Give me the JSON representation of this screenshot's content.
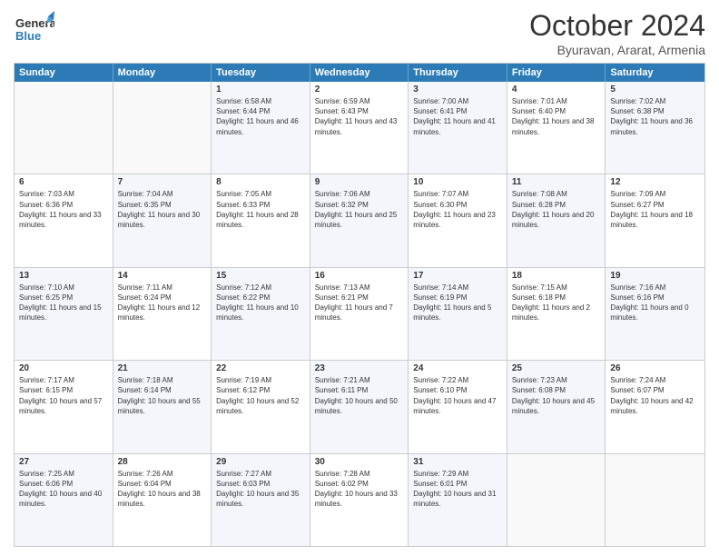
{
  "header": {
    "logo_general": "General",
    "logo_blue": "Blue",
    "month_title": "October 2024",
    "subtitle": "Byuravan, Ararat, Armenia"
  },
  "days_of_week": [
    "Sunday",
    "Monday",
    "Tuesday",
    "Wednesday",
    "Thursday",
    "Friday",
    "Saturday"
  ],
  "weeks": [
    [
      {
        "day": "",
        "sunrise": "",
        "sunset": "",
        "daylight": "",
        "empty": true
      },
      {
        "day": "",
        "sunrise": "",
        "sunset": "",
        "daylight": "",
        "empty": true
      },
      {
        "day": "1",
        "sunrise": "Sunrise: 6:58 AM",
        "sunset": "Sunset: 6:44 PM",
        "daylight": "Daylight: 11 hours and 46 minutes."
      },
      {
        "day": "2",
        "sunrise": "Sunrise: 6:59 AM",
        "sunset": "Sunset: 6:43 PM",
        "daylight": "Daylight: 11 hours and 43 minutes."
      },
      {
        "day": "3",
        "sunrise": "Sunrise: 7:00 AM",
        "sunset": "Sunset: 6:41 PM",
        "daylight": "Daylight: 11 hours and 41 minutes."
      },
      {
        "day": "4",
        "sunrise": "Sunrise: 7:01 AM",
        "sunset": "Sunset: 6:40 PM",
        "daylight": "Daylight: 11 hours and 38 minutes."
      },
      {
        "day": "5",
        "sunrise": "Sunrise: 7:02 AM",
        "sunset": "Sunset: 6:38 PM",
        "daylight": "Daylight: 11 hours and 36 minutes."
      }
    ],
    [
      {
        "day": "6",
        "sunrise": "Sunrise: 7:03 AM",
        "sunset": "Sunset: 6:36 PM",
        "daylight": "Daylight: 11 hours and 33 minutes."
      },
      {
        "day": "7",
        "sunrise": "Sunrise: 7:04 AM",
        "sunset": "Sunset: 6:35 PM",
        "daylight": "Daylight: 11 hours and 30 minutes."
      },
      {
        "day": "8",
        "sunrise": "Sunrise: 7:05 AM",
        "sunset": "Sunset: 6:33 PM",
        "daylight": "Daylight: 11 hours and 28 minutes."
      },
      {
        "day": "9",
        "sunrise": "Sunrise: 7:06 AM",
        "sunset": "Sunset: 6:32 PM",
        "daylight": "Daylight: 11 hours and 25 minutes."
      },
      {
        "day": "10",
        "sunrise": "Sunrise: 7:07 AM",
        "sunset": "Sunset: 6:30 PM",
        "daylight": "Daylight: 11 hours and 23 minutes."
      },
      {
        "day": "11",
        "sunrise": "Sunrise: 7:08 AM",
        "sunset": "Sunset: 6:28 PM",
        "daylight": "Daylight: 11 hours and 20 minutes."
      },
      {
        "day": "12",
        "sunrise": "Sunrise: 7:09 AM",
        "sunset": "Sunset: 6:27 PM",
        "daylight": "Daylight: 11 hours and 18 minutes."
      }
    ],
    [
      {
        "day": "13",
        "sunrise": "Sunrise: 7:10 AM",
        "sunset": "Sunset: 6:25 PM",
        "daylight": "Daylight: 11 hours and 15 minutes."
      },
      {
        "day": "14",
        "sunrise": "Sunrise: 7:11 AM",
        "sunset": "Sunset: 6:24 PM",
        "daylight": "Daylight: 11 hours and 12 minutes."
      },
      {
        "day": "15",
        "sunrise": "Sunrise: 7:12 AM",
        "sunset": "Sunset: 6:22 PM",
        "daylight": "Daylight: 11 hours and 10 minutes."
      },
      {
        "day": "16",
        "sunrise": "Sunrise: 7:13 AM",
        "sunset": "Sunset: 6:21 PM",
        "daylight": "Daylight: 11 hours and 7 minutes."
      },
      {
        "day": "17",
        "sunrise": "Sunrise: 7:14 AM",
        "sunset": "Sunset: 6:19 PM",
        "daylight": "Daylight: 11 hours and 5 minutes."
      },
      {
        "day": "18",
        "sunrise": "Sunrise: 7:15 AM",
        "sunset": "Sunset: 6:18 PM",
        "daylight": "Daylight: 11 hours and 2 minutes."
      },
      {
        "day": "19",
        "sunrise": "Sunrise: 7:16 AM",
        "sunset": "Sunset: 6:16 PM",
        "daylight": "Daylight: 11 hours and 0 minutes."
      }
    ],
    [
      {
        "day": "20",
        "sunrise": "Sunrise: 7:17 AM",
        "sunset": "Sunset: 6:15 PM",
        "daylight": "Daylight: 10 hours and 57 minutes."
      },
      {
        "day": "21",
        "sunrise": "Sunrise: 7:18 AM",
        "sunset": "Sunset: 6:14 PM",
        "daylight": "Daylight: 10 hours and 55 minutes."
      },
      {
        "day": "22",
        "sunrise": "Sunrise: 7:19 AM",
        "sunset": "Sunset: 6:12 PM",
        "daylight": "Daylight: 10 hours and 52 minutes."
      },
      {
        "day": "23",
        "sunrise": "Sunrise: 7:21 AM",
        "sunset": "Sunset: 6:11 PM",
        "daylight": "Daylight: 10 hours and 50 minutes."
      },
      {
        "day": "24",
        "sunrise": "Sunrise: 7:22 AM",
        "sunset": "Sunset: 6:10 PM",
        "daylight": "Daylight: 10 hours and 47 minutes."
      },
      {
        "day": "25",
        "sunrise": "Sunrise: 7:23 AM",
        "sunset": "Sunset: 6:08 PM",
        "daylight": "Daylight: 10 hours and 45 minutes."
      },
      {
        "day": "26",
        "sunrise": "Sunrise: 7:24 AM",
        "sunset": "Sunset: 6:07 PM",
        "daylight": "Daylight: 10 hours and 42 minutes."
      }
    ],
    [
      {
        "day": "27",
        "sunrise": "Sunrise: 7:25 AM",
        "sunset": "Sunset: 6:06 PM",
        "daylight": "Daylight: 10 hours and 40 minutes."
      },
      {
        "day": "28",
        "sunrise": "Sunrise: 7:26 AM",
        "sunset": "Sunset: 6:04 PM",
        "daylight": "Daylight: 10 hours and 38 minutes."
      },
      {
        "day": "29",
        "sunrise": "Sunrise: 7:27 AM",
        "sunset": "Sunset: 6:03 PM",
        "daylight": "Daylight: 10 hours and 35 minutes."
      },
      {
        "day": "30",
        "sunrise": "Sunrise: 7:28 AM",
        "sunset": "Sunset: 6:02 PM",
        "daylight": "Daylight: 10 hours and 33 minutes."
      },
      {
        "day": "31",
        "sunrise": "Sunrise: 7:29 AM",
        "sunset": "Sunset: 6:01 PM",
        "daylight": "Daylight: 10 hours and 31 minutes."
      },
      {
        "day": "",
        "sunrise": "",
        "sunset": "",
        "daylight": "",
        "empty": true
      },
      {
        "day": "",
        "sunrise": "",
        "sunset": "",
        "daylight": "",
        "empty": true
      }
    ]
  ]
}
